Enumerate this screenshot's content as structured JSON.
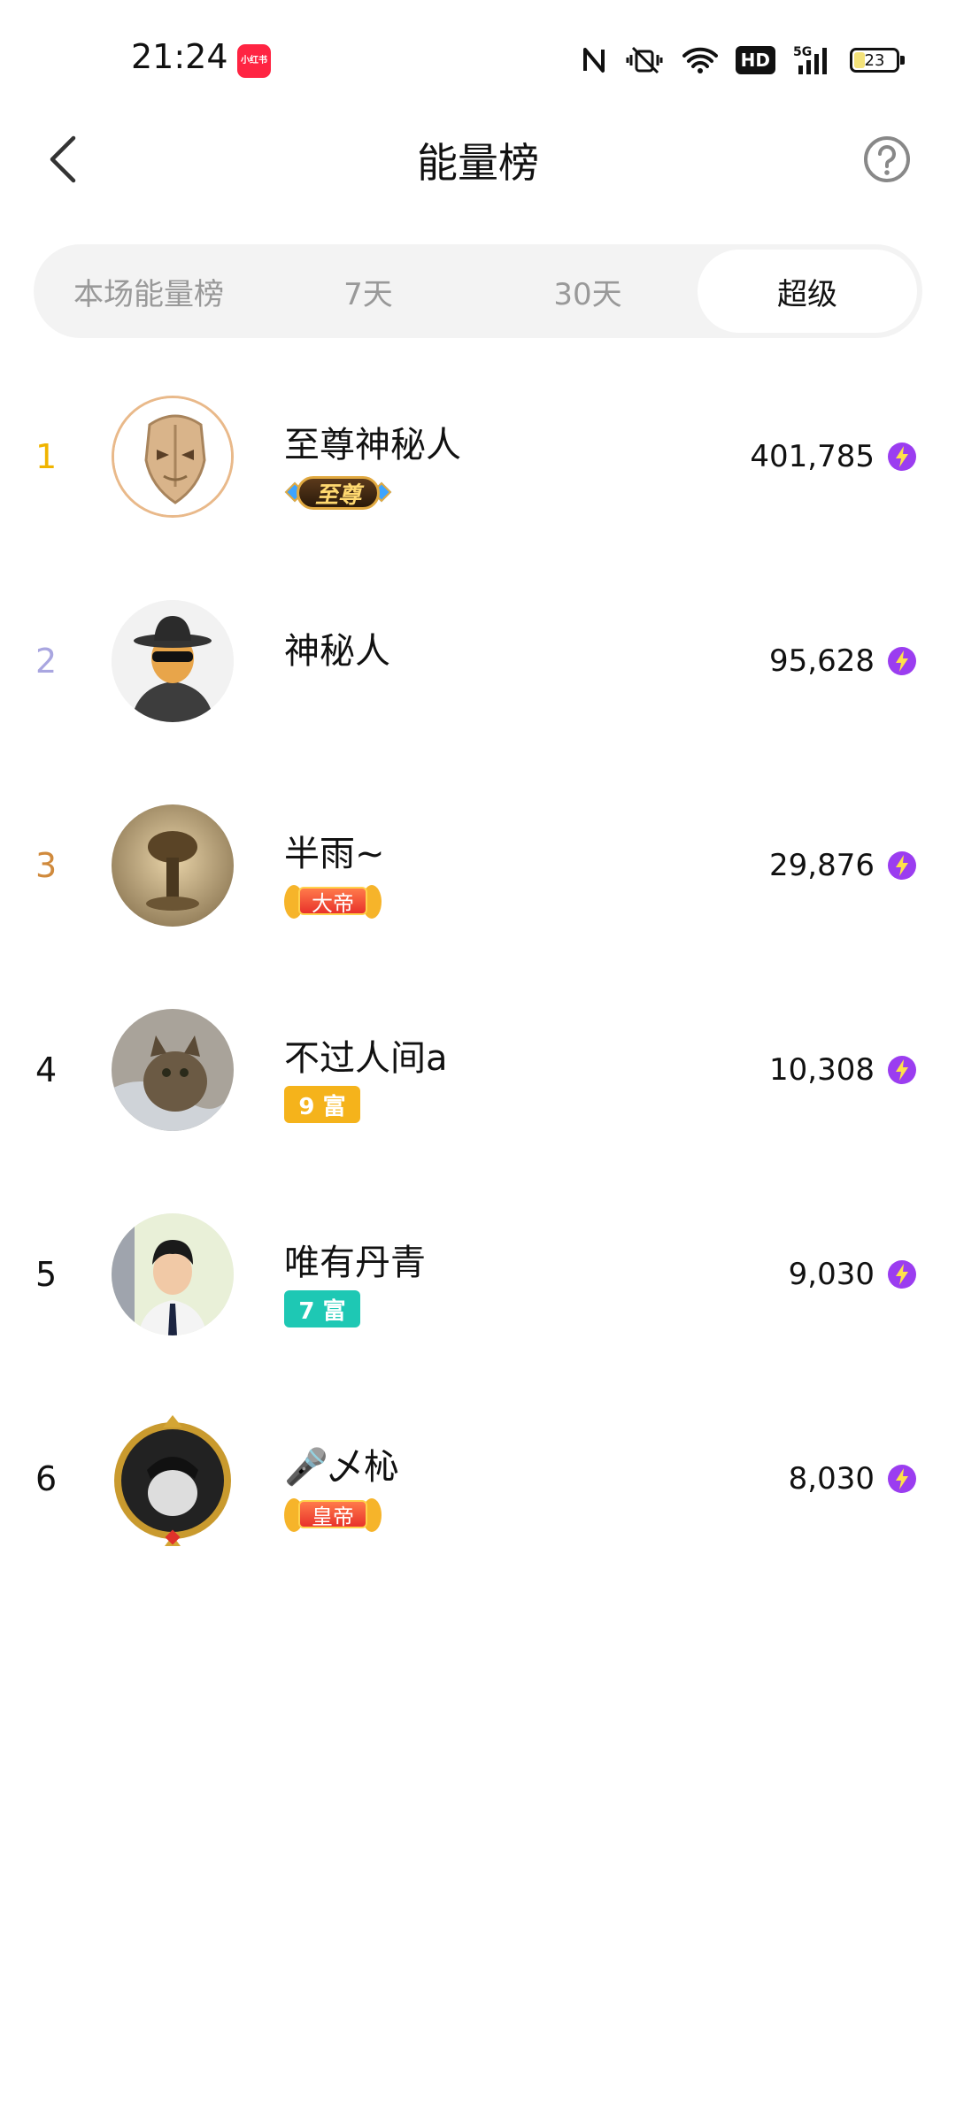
{
  "status_bar": {
    "time": "21:24",
    "app_badge": "小红书",
    "network": "5G",
    "hd": "HD",
    "battery": "23"
  },
  "header": {
    "title": "能量榜"
  },
  "tabs": [
    {
      "label": "本场能量榜",
      "active": false
    },
    {
      "label": "7天",
      "active": false
    },
    {
      "label": "30天",
      "active": false
    },
    {
      "label": "超级",
      "active": true
    }
  ],
  "rank_colors": {
    "1": "#f0b400",
    "2": "#a9a6e0",
    "3": "#d08a3c",
    "default": "#111111"
  },
  "ranking": [
    {
      "rank": "1",
      "name": "至尊神秘人",
      "badge_type": "zhizun",
      "badge_text": "至尊",
      "score": "401,785",
      "avatar": "gold-mask-avatar"
    },
    {
      "rank": "2",
      "name": "神秘人",
      "badge_type": "none",
      "badge_text": "",
      "score": "95,628",
      "avatar": "spy-avatar"
    },
    {
      "rank": "3",
      "name": "半雨~",
      "badge_type": "ribbon",
      "badge_text": "大帝",
      "score": "29,876",
      "avatar": "explosion-avatar"
    },
    {
      "rank": "4",
      "name": "不过人间a",
      "badge_type": "level",
      "badge_text": "9 富",
      "badge_color": "#f5b31b",
      "score": "10,308",
      "avatar": "cat-avatar"
    },
    {
      "rank": "5",
      "name": "唯有丹青",
      "badge_type": "level",
      "badge_text": "7 富",
      "badge_color": "#1ec8b4",
      "score": "9,030",
      "avatar": "boy-avatar"
    },
    {
      "rank": "6",
      "name": "🎤乄杺",
      "badge_type": "ribbon",
      "badge_text": "皇帝",
      "score": "8,030",
      "avatar": "framed-avatar"
    }
  ]
}
